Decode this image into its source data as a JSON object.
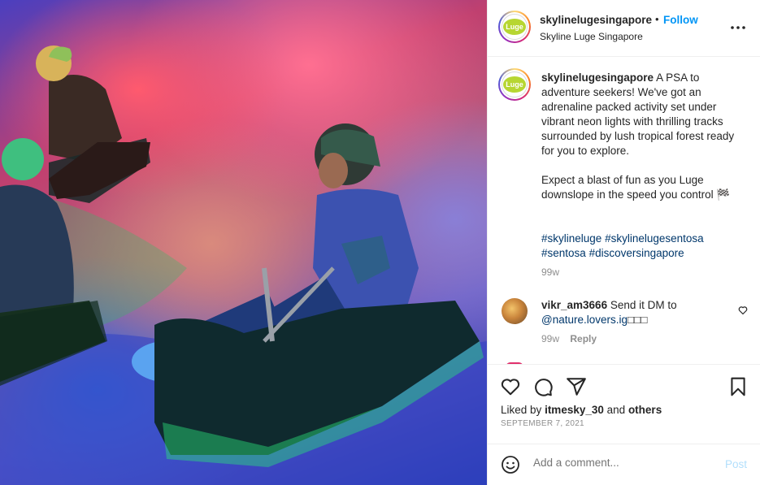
{
  "post": {
    "username": "skylinelugesingapore",
    "follow_label": "Follow",
    "dot": "•",
    "location": "Skyline Luge Singapore",
    "more_icon": "more-horizontal-icon",
    "avatar_logo_text": "Luge"
  },
  "caption": {
    "username": "skylinelugesingapore",
    "paragraph1": "A PSA to adventure seekers! We've got an adrenaline packed activity set under vibrant neon lights with thrilling tracks surrounded by lush tropical forest ready for you to explore.",
    "paragraph2": "Expect a blast of fun as you Luge downslope in the speed you control 🏁",
    "hashtags": [
      "#skylineluge",
      "#skylinelugesentosa",
      "#sentosa",
      "#discoversingapore"
    ],
    "time": "99w"
  },
  "comments": [
    {
      "username": "vikr_am3666",
      "text": "Send it DM to",
      "mention": "@nature.lovers.ig",
      "trailing": "□□□",
      "time": "99w",
      "reply_label": "Reply"
    }
  ],
  "actions": {
    "icons": [
      "heart-icon",
      "comment-icon",
      "share-icon",
      "bookmark-icon"
    ],
    "liked_prefix": "Liked by",
    "liked_user": "itmesky_30",
    "liked_and": "and",
    "liked_others": "others",
    "date": "SEPTEMBER 7, 2021"
  },
  "add_comment": {
    "placeholder": "Add a comment...",
    "post_label": "Post"
  },
  "colors": {
    "link": "#0095f6",
    "hashtag": "#00376b",
    "muted": "#8e8e8e",
    "post_disabled": "#b2dffc"
  }
}
